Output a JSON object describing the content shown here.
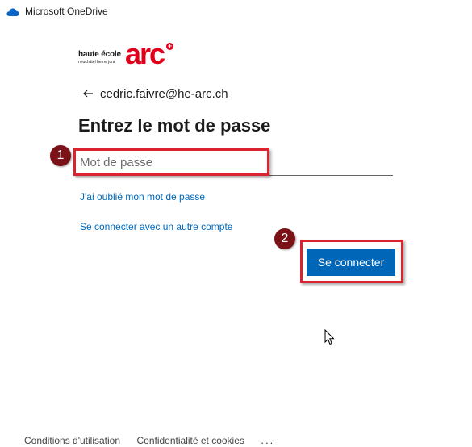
{
  "window": {
    "title": "Microsoft OneDrive",
    "icon": "onedrive-cloud-icon"
  },
  "logo": {
    "line1": "haute école",
    "line2": "neuchâtel berne jura",
    "mark": "arc",
    "plus": "+",
    "color": "#e2001a"
  },
  "identity": {
    "back_icon": "arrow-left-icon",
    "email": "cedric.faivre@he-arc.ch"
  },
  "heading": "Entrez le mot de passe",
  "password": {
    "placeholder": "Mot de passe",
    "value": ""
  },
  "links": {
    "forgot": "J'ai oublié mon mot de passe",
    "other_account": "Se connecter avec un autre compte"
  },
  "signin_button": "Se connecter",
  "annotations": {
    "step1": "1",
    "step2": "2",
    "highlight_color": "#d9232e",
    "badge_color": "#7b1217"
  },
  "footer": {
    "terms": "Conditions d'utilisation",
    "privacy": "Confidentialité et cookies",
    "more": "..."
  },
  "colors": {
    "accent": "#0067b8",
    "text": "#1b1b1b"
  }
}
